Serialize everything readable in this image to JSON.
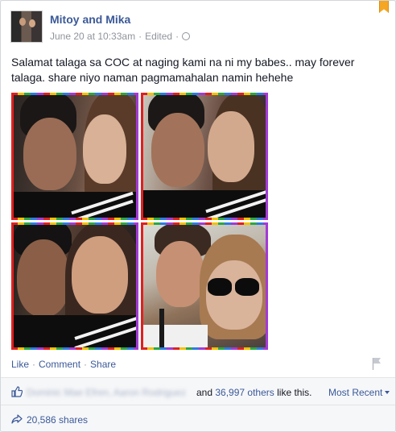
{
  "post": {
    "author": "Mitoy and Mika",
    "date": "June 20 at 10:33am",
    "edited_label": "Edited",
    "separator": "·",
    "privacy_icon": "globe-icon",
    "text": "Salamat talaga sa COC at naging kami na ni my babes.. may forever talaga. share niyo naman pagmamahalan namin hehehe",
    "photo_alt": "Photo collage of a couple"
  },
  "actions": {
    "like": "Like",
    "comment": "Comment",
    "share": "Share",
    "dot": "·"
  },
  "likes": {
    "blurred_names": "Dominic Mae Efren, Aaron Rodriguez",
    "and_text": "and",
    "others_link": "36,997 others",
    "suffix": "like this.",
    "sort_label": "Most Recent"
  },
  "shares": {
    "label": "20,586 shares"
  },
  "colors": {
    "brand": "#3b5998",
    "meta_gray": "#90949c",
    "bookmark": "#f5a623"
  }
}
